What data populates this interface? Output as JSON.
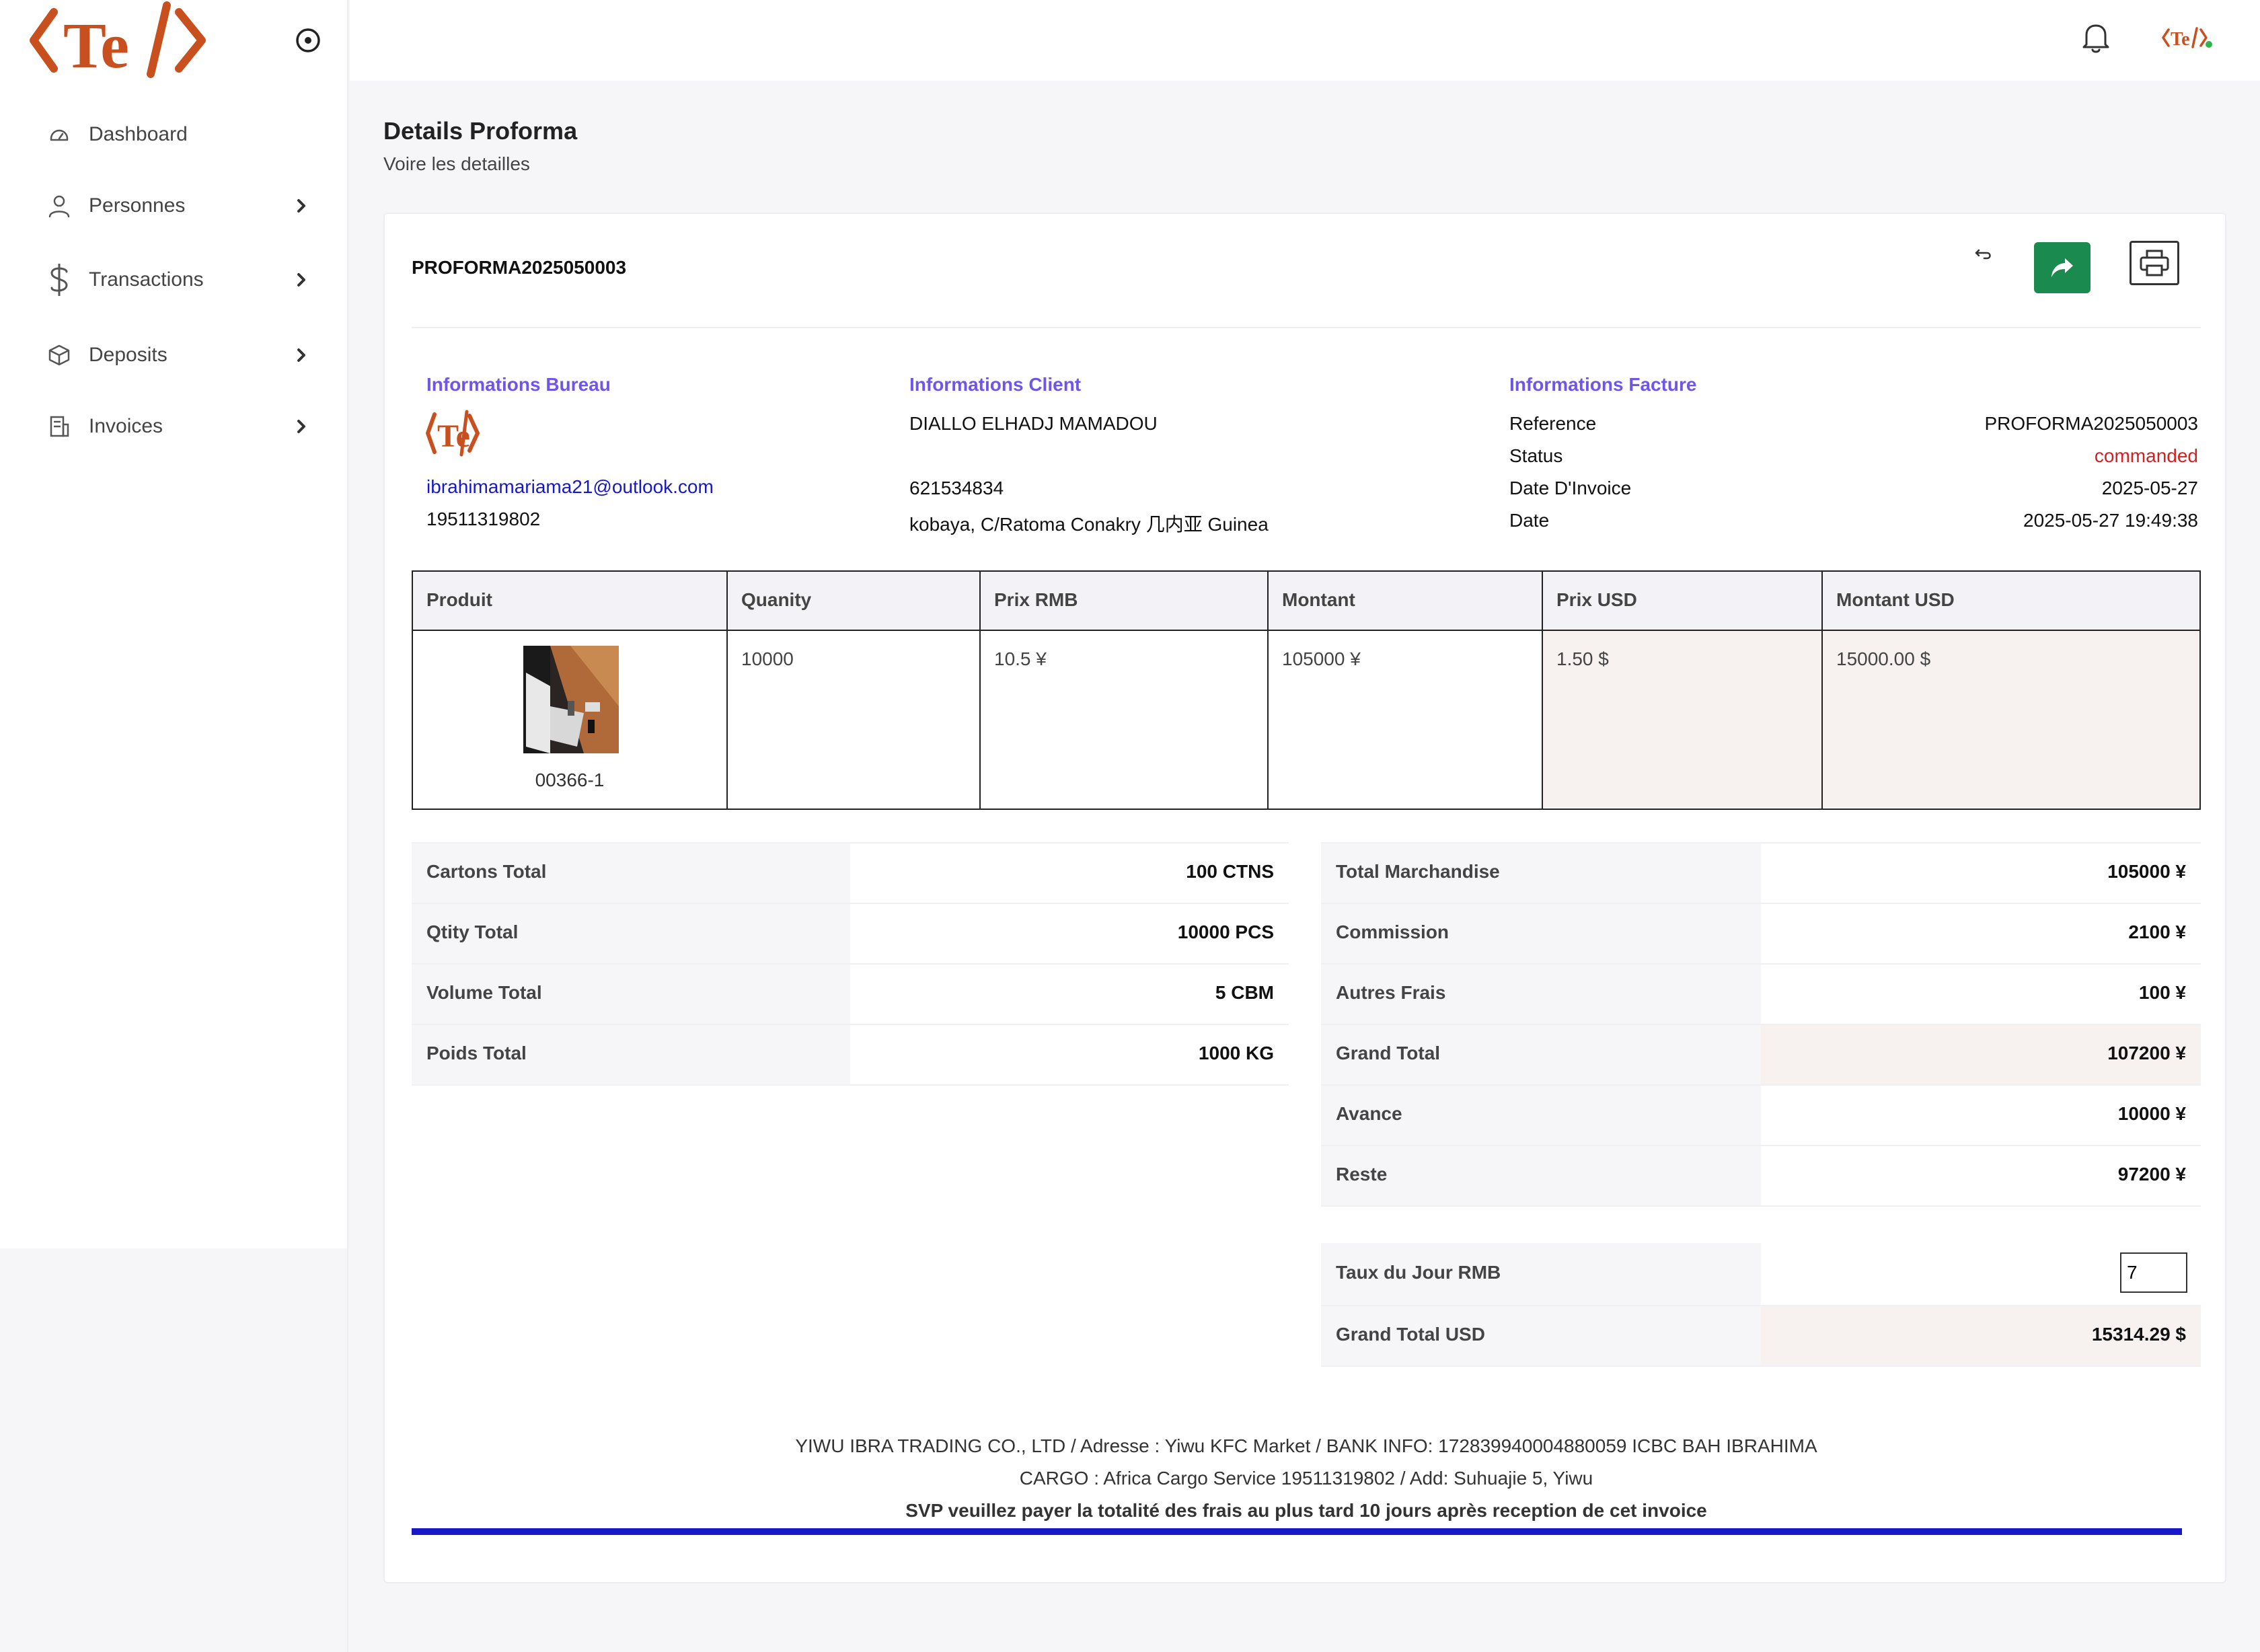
{
  "sidebar": {
    "logo_text": "Te",
    "items": [
      {
        "label": "Dashboard"
      },
      {
        "label": "Personnes"
      },
      {
        "label": "Transactions"
      },
      {
        "label": "Deposits"
      },
      {
        "label": "Invoices"
      }
    ]
  },
  "header": {
    "logo_text": "Te"
  },
  "page": {
    "title": "Details Proforma",
    "subtitle": "Voire les detailles"
  },
  "invoice": {
    "reference_title": "PROFORMA2025050003",
    "bureau": {
      "title": "Informations Bureau",
      "logo_text": "Te",
      "email": "ibrahimamariama21@outlook.com",
      "phone": "19511319802"
    },
    "client": {
      "title": "Informations Client",
      "name": "DIALLO ELHADJ MAMADOU",
      "phone": "621534834",
      "address": "kobaya, C/Ratoma Conakry 几内亚 Guinea"
    },
    "facture": {
      "title": "Informations Facture",
      "rows": [
        {
          "label": "Reference",
          "value": "PROFORMA2025050003"
        },
        {
          "label": "Status",
          "value": "commanded"
        },
        {
          "label": "Date D'Invoice",
          "value": "2025-05-27"
        },
        {
          "label": "Date",
          "value": "2025-05-27 19:49:38"
        }
      ]
    },
    "items_table": {
      "headers": [
        "Produit",
        "Quanity",
        "Prix RMB",
        "Montant",
        "Prix USD",
        "Montant USD"
      ],
      "rows": [
        {
          "code": "00366-1",
          "quantity": "10000",
          "prix_rmb": "10.5 ¥",
          "montant": "105000 ¥",
          "prix_usd": "1.50 $",
          "montant_usd": "15000.00 $"
        }
      ]
    },
    "totals_left": [
      {
        "label": "Cartons Total",
        "value": "100 CTNS"
      },
      {
        "label": "Qtity Total",
        "value": "10000 PCS"
      },
      {
        "label": "Volume Total",
        "value": "5 CBM"
      },
      {
        "label": "Poids Total",
        "value": "1000 KG"
      }
    ],
    "totals_right": [
      {
        "label": "Total Marchandise",
        "value": "105000 ¥"
      },
      {
        "label": "Commission",
        "value": "2100 ¥"
      },
      {
        "label": "Autres Frais",
        "value": "100 ¥"
      },
      {
        "label": "Grand Total",
        "value": "107200 ¥"
      },
      {
        "label": "Avance",
        "value": "10000 ¥"
      },
      {
        "label": "Reste",
        "value": "97200 ¥"
      }
    ],
    "rate": {
      "label": "Taux du Jour RMB",
      "value": "7"
    },
    "grand_total_usd": {
      "label": "Grand Total USD",
      "value": "15314.29 $"
    },
    "footer": {
      "line1": "YIWU IBRA TRADING CO., LTD / Adresse : Yiwu KFC Market / BANK INFO: 172839940004880059 ICBC BAH IBRAHIMA",
      "line2": "CARGO : Africa Cargo Service 19511319802 / Add: Suhuajie 5, Yiwu",
      "line3": "SVP veuillez payer la totalité des frais au plus tard 10 jours après reception de cet invoice"
    }
  },
  "colors": {
    "brand": "#c8501e",
    "accent": "#6f55e8",
    "share_button": "#1a8a4e",
    "status": "#d42020",
    "link": "#1818c8"
  },
  "icons": [
    "target-icon",
    "dashboard-icon",
    "person-icon",
    "dollar-icon",
    "box-icon",
    "invoice-icon",
    "chevron-right-icon",
    "bell-icon",
    "undo-icon",
    "share-icon",
    "print-icon"
  ]
}
